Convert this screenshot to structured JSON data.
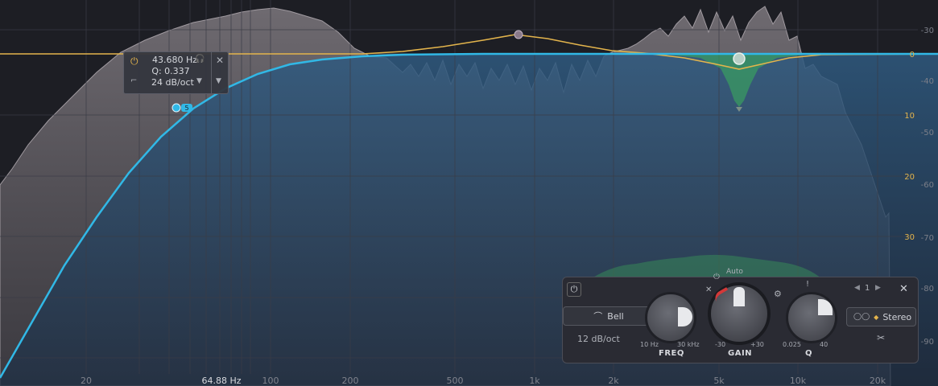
{
  "db_scale_right": [
    "-30",
    "-40",
    "-50",
    "-60",
    "-70",
    "-80",
    "-90"
  ],
  "db_scale_gain": [
    "0",
    "10",
    "20",
    "30"
  ],
  "freq_axis": [
    "20",
    "100",
    "200",
    "500",
    "1k",
    "2k",
    "5k",
    "10k",
    "20k"
  ],
  "cursor_freq": "64.88 Hz",
  "band_popup": {
    "freq": "43.680 Hz",
    "q": "Q: 0.337",
    "slope": "24 dB/oct"
  },
  "band_node_label": "5",
  "panel": {
    "auto_label": "Auto",
    "shape_label": "Bell",
    "slope_label": "12 dB/oct",
    "freq": {
      "label": "FREQ",
      "min": "10 Hz",
      "max": "30 kHz"
    },
    "gain": {
      "label": "GAIN",
      "min": "-30",
      "max": "+30"
    },
    "q": {
      "label": "Q",
      "min": "0.025",
      "max": "40"
    },
    "band_index": "1",
    "stereo_label": "Stereo"
  },
  "colors": {
    "accent_blue": "#31b8e6",
    "gold": "#e3b44c",
    "green": "#3bb35a"
  }
}
